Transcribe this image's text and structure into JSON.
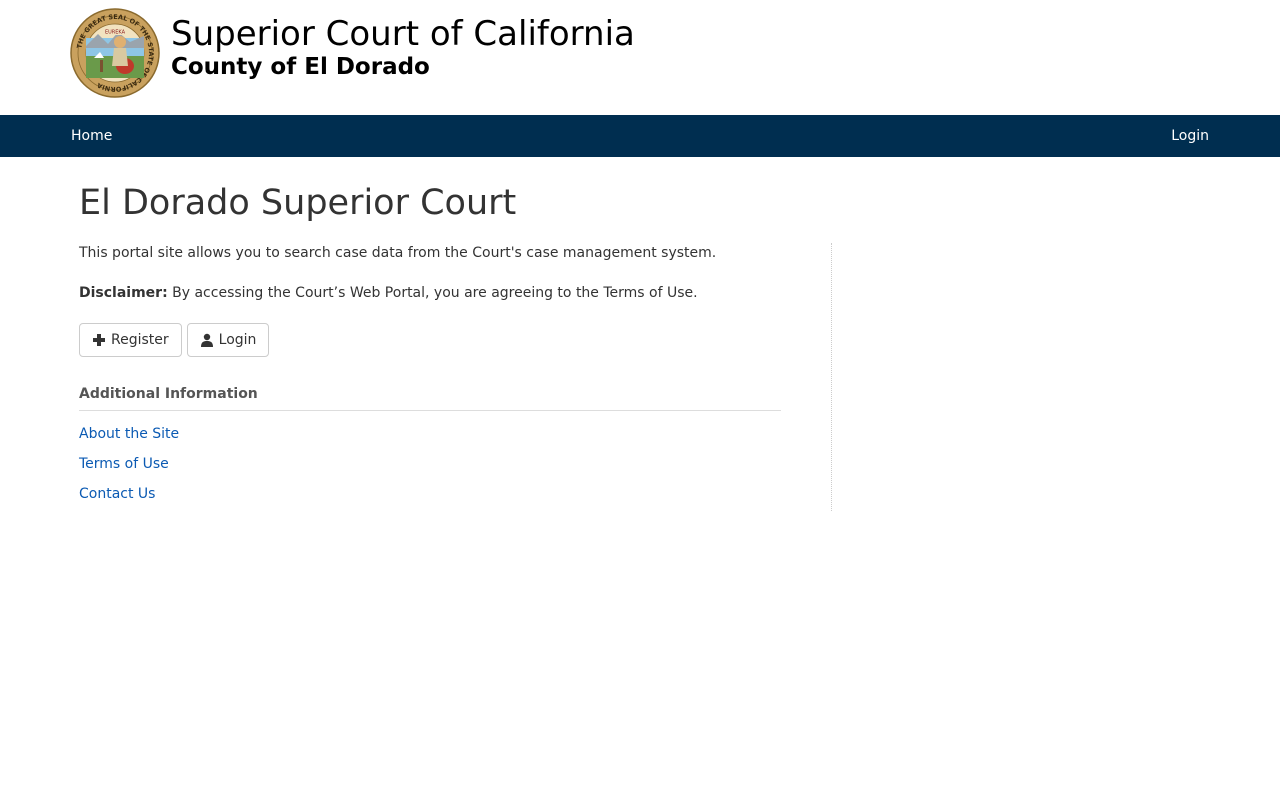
{
  "header": {
    "court_name": "Superior Court of California",
    "county_name": "County of El Dorado",
    "seal_icon": "california-state-seal-icon",
    "seal_text": "THE GREAT SEAL OF THE STATE OF CALIFORNIA",
    "seal_motto": "EUREKA"
  },
  "nav": {
    "home_label": "Home",
    "login_label": "Login",
    "background": "#002e50"
  },
  "main": {
    "title": "El Dorado Superior Court",
    "intro": "This portal site allows you to search case data from the Court's case management system.",
    "disclaimer_label": "Disclaimer:",
    "disclaimer_text": "By accessing the Court’s Web Portal, you are agreeing to the Terms of Use.",
    "register_button": {
      "label": "Register",
      "icon": "plus-icon"
    },
    "login_button": {
      "label": "Login",
      "icon": "user-icon"
    },
    "additional_info": {
      "heading": "Additional Information",
      "links": [
        {
          "label": "About the Site"
        },
        {
          "label": "Terms of Use"
        },
        {
          "label": "Contact Us"
        }
      ]
    },
    "link_color": "#0b5ab3"
  }
}
